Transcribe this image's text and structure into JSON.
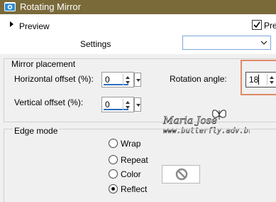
{
  "window": {
    "title": "Rotating Mirror"
  },
  "preview": {
    "label": "Preview",
    "checkbox_label": "Pre",
    "checked": true
  },
  "settings": {
    "label": "Settings",
    "value": ""
  },
  "mirror_placement": {
    "legend": "Mirror placement",
    "horizontal_offset": {
      "label": "Horizontal offset (%):",
      "value": "0"
    },
    "vertical_offset": {
      "label": "Vertical offset (%):",
      "value": "0"
    },
    "rotation_angle": {
      "label": "Rotation angle:",
      "value": "18"
    }
  },
  "edge_mode": {
    "legend": "Edge mode",
    "options": [
      {
        "label": "Wrap",
        "selected": false
      },
      {
        "label": "Repeat",
        "selected": false
      },
      {
        "label": "Color",
        "selected": false
      },
      {
        "label": "Reflect",
        "selected": true
      }
    ],
    "color_swatch_icon": "no-color-icon"
  },
  "watermark": {
    "signature": "Maria José",
    "url": "www.butterfly.adv.br"
  },
  "colors": {
    "titlebar": "#7a6a3a",
    "highlight": "#e08a6a",
    "spin_underline": "#2a6fc0",
    "select_border": "#7aa6d9"
  }
}
